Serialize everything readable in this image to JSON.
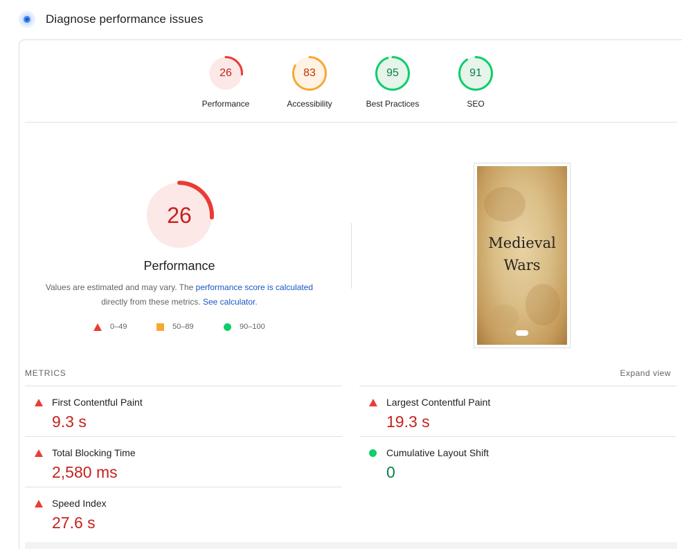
{
  "header": {
    "title": "Diagnose performance issues"
  },
  "colors": {
    "fail": "#eb3b35",
    "fail_text": "#c5221f",
    "average": "#f8a832",
    "average_text": "#c33300",
    "pass": "#0cce6b",
    "pass_text": "#0b8043",
    "link": "#1a56c5"
  },
  "categories": [
    {
      "label": "Performance",
      "score": "26",
      "value": 26,
      "status": "fail"
    },
    {
      "label": "Accessibility",
      "score": "83",
      "value": 83,
      "status": "average"
    },
    {
      "label": "Best Practices",
      "score": "95",
      "value": 95,
      "status": "pass"
    },
    {
      "label": "SEO",
      "score": "91",
      "value": 91,
      "status": "pass"
    }
  ],
  "performance": {
    "score": "26",
    "value": 26,
    "title": "Performance",
    "desc_prefix": "Values are estimated and may vary. The ",
    "desc_link": "performance score is calculated",
    "desc_middle": " directly from these metrics. ",
    "calc_link": "See calculator",
    "desc_suffix": "."
  },
  "legend": [
    {
      "range": "0–49",
      "shape": "triangle"
    },
    {
      "range": "50–89",
      "shape": "square"
    },
    {
      "range": "90–100",
      "shape": "circle"
    }
  ],
  "screenshot": {
    "line1": "Medieval",
    "line2": "Wars"
  },
  "metrics": {
    "label": "METRICS",
    "expand": "Expand view",
    "items": [
      {
        "name": "First Contentful Paint",
        "value": "9.3 s",
        "status": "fail"
      },
      {
        "name": "Largest Contentful Paint",
        "value": "19.3 s",
        "status": "fail"
      },
      {
        "name": "Total Blocking Time",
        "value": "2,580 ms",
        "status": "fail"
      },
      {
        "name": "Cumulative Layout Shift",
        "value": "0",
        "status": "pass"
      },
      {
        "name": "Speed Index",
        "value": "27.6 s",
        "status": "fail"
      }
    ]
  }
}
